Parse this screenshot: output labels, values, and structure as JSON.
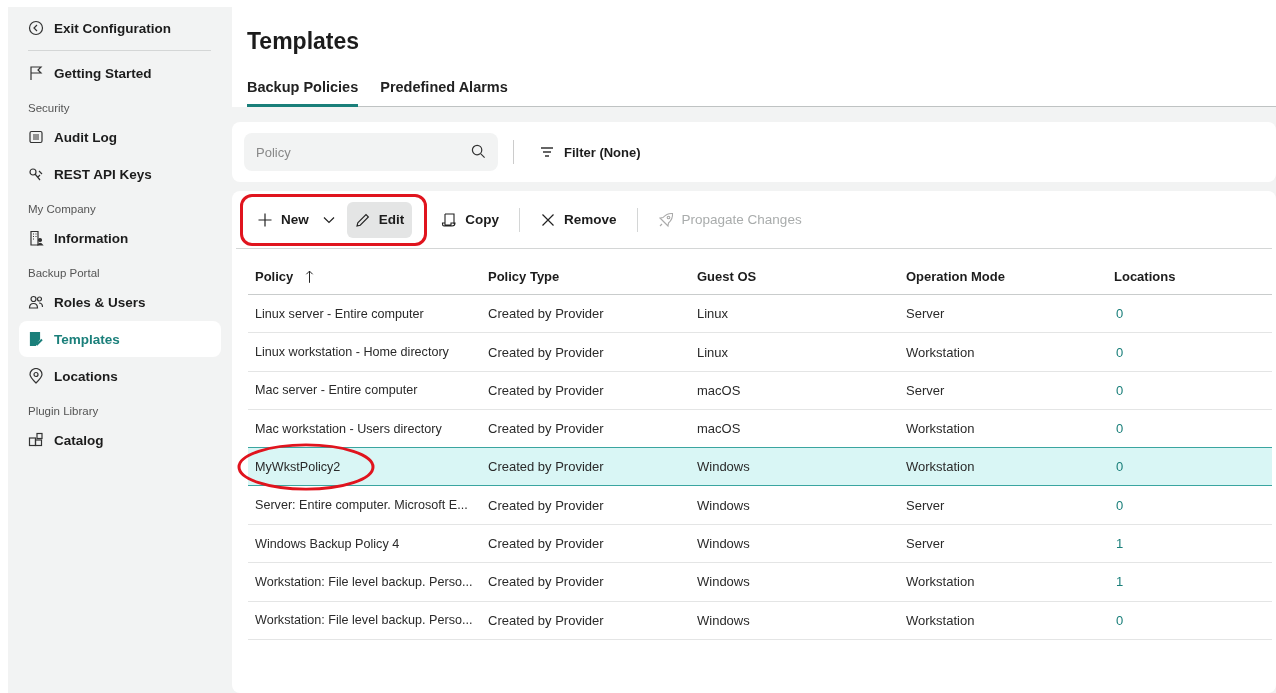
{
  "sidebar": {
    "exit": {
      "label": "Exit Configuration"
    },
    "items": [
      {
        "kind": "item",
        "label": "Getting Started",
        "selected": false
      },
      {
        "kind": "section",
        "label": "Security"
      },
      {
        "kind": "item",
        "label": "Audit Log",
        "selected": false
      },
      {
        "kind": "item",
        "label": "REST API Keys",
        "selected": false
      },
      {
        "kind": "section",
        "label": "My Company"
      },
      {
        "kind": "item",
        "label": "Information",
        "selected": false
      },
      {
        "kind": "section",
        "label": "Backup Portal"
      },
      {
        "kind": "item",
        "label": "Roles & Users",
        "selected": false
      },
      {
        "kind": "item",
        "label": "Templates",
        "selected": true
      },
      {
        "kind": "item",
        "label": "Locations",
        "selected": false
      },
      {
        "kind": "section",
        "label": "Plugin Library"
      },
      {
        "kind": "item",
        "label": "Catalog",
        "selected": false
      }
    ]
  },
  "page": {
    "title": "Templates"
  },
  "tabs": [
    {
      "label": "Backup Policies",
      "selected": true
    },
    {
      "label": "Predefined Alarms",
      "selected": false
    }
  ],
  "search": {
    "placeholder": "Policy"
  },
  "filter": {
    "label": "Filter (None)"
  },
  "toolbar": {
    "annotated_buttons": [
      {
        "label": "New",
        "kind": "dropdown",
        "pressed": false,
        "disabled": false
      },
      {
        "label": "Edit",
        "kind": "edit",
        "pressed": true,
        "disabled": false
      }
    ],
    "buttons": [
      {
        "label": "Copy",
        "kind": "copy",
        "pressed": false,
        "disabled": false
      },
      {
        "label": "Remove",
        "kind": "remove",
        "pressed": false,
        "disabled": false
      },
      {
        "label": "Propagate Changes",
        "kind": "propagate",
        "pressed": false,
        "disabled": true
      }
    ]
  },
  "table": {
    "columns": [
      {
        "label": "Policy",
        "sorted": true
      },
      {
        "label": "Policy Type",
        "sorted": false
      },
      {
        "label": "Guest OS",
        "sorted": false
      },
      {
        "label": "Operation Mode",
        "sorted": false
      },
      {
        "label": "Locations",
        "sorted": false
      }
    ],
    "rows": [
      {
        "cells": [
          "Linux server - Entire computer",
          "Created by Provider",
          "Linux",
          "Server",
          "0"
        ],
        "selected": false,
        "circled": false
      },
      {
        "cells": [
          "Linux workstation - Home directory",
          "Created by Provider",
          "Linux",
          "Workstation",
          "0"
        ],
        "selected": false,
        "circled": false
      },
      {
        "cells": [
          "Mac server - Entire computer",
          "Created by Provider",
          "macOS",
          "Server",
          "0"
        ],
        "selected": false,
        "circled": false
      },
      {
        "cells": [
          "Mac workstation - Users directory",
          "Created by Provider",
          "macOS",
          "Workstation",
          "0"
        ],
        "selected": false,
        "circled": false
      },
      {
        "cells": [
          "MyWkstPolicy2",
          "Created by Provider",
          "Windows",
          "Workstation",
          "0"
        ],
        "selected": true,
        "circled": true
      },
      {
        "cells": [
          "Server: Entire computer. Microsoft E...",
          "Created by Provider",
          "Windows",
          "Server",
          "0"
        ],
        "selected": false,
        "circled": false
      },
      {
        "cells": [
          "Windows Backup Policy 4",
          "Created by Provider",
          "Windows",
          "Server",
          "1"
        ],
        "selected": false,
        "circled": false
      },
      {
        "cells": [
          "Workstation: File level backup. Perso...",
          "Created by Provider",
          "Windows",
          "Workstation",
          "1"
        ],
        "selected": false,
        "circled": false
      },
      {
        "cells": [
          "Workstation: File level backup. Perso...",
          "Created by Provider",
          "Windows",
          "Workstation",
          "0"
        ],
        "selected": false,
        "circled": false
      }
    ]
  }
}
